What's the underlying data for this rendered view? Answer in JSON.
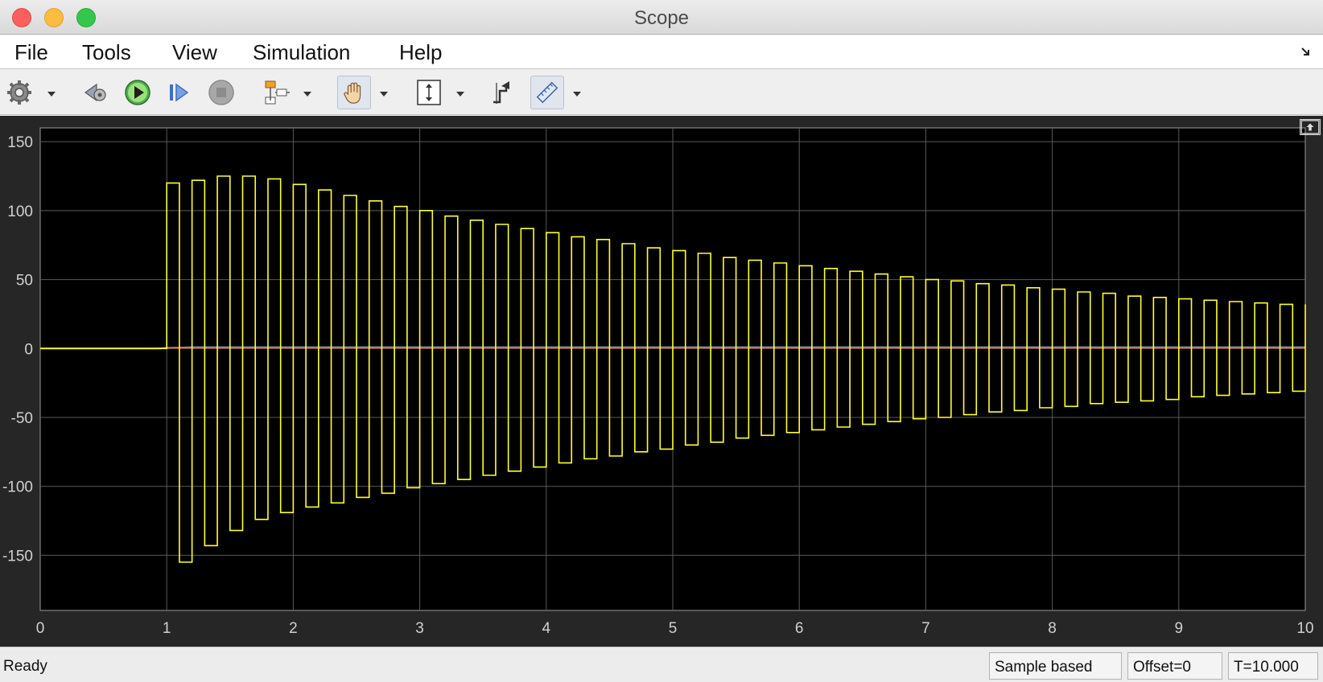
{
  "window": {
    "title": "Scope"
  },
  "menu": {
    "file": "File",
    "tools": "Tools",
    "view": "View",
    "simulation": "Simulation",
    "help": "Help"
  },
  "toolbar": {
    "icons": [
      "gear-icon",
      "step-back-icon",
      "run-icon",
      "step-forward-icon",
      "stop-icon",
      "signal-routing-icon",
      "pan-hand-icon",
      "scale-axes-icon",
      "triggers-icon",
      "cursor-measurements-icon"
    ]
  },
  "status": {
    "text": "Ready",
    "mode": "Sample based",
    "offset": "Offset=0",
    "time": "T=10.000"
  },
  "colors": {
    "plot_background": "#000000",
    "panel_background": "#262626",
    "grid": "#5a5a5a",
    "signal_1": "#ffff33",
    "signal_2": "#3b8be8",
    "signal_3": "#e8792a"
  },
  "chart_data": {
    "type": "line",
    "title": "",
    "xlabel": "",
    "ylabel": "",
    "xlim": [
      0,
      10
    ],
    "ylim": [
      -190,
      160
    ],
    "xticks": [
      "0",
      "1",
      "2",
      "3",
      "4",
      "5",
      "6",
      "7",
      "8",
      "9",
      "10"
    ],
    "yticks": [
      "150",
      "100",
      "50",
      "0",
      "-50",
      "-100",
      "-150"
    ],
    "grid": true,
    "series": [
      {
        "color": "#ffff33",
        "style": "square-wave",
        "start_time": 1.0,
        "period": 0.2,
        "duty": 0.5,
        "positive_peaks": [
          120,
          122,
          125,
          125,
          123,
          119,
          115,
          111,
          107,
          103,
          100,
          96,
          93,
          90,
          87,
          84,
          81,
          79,
          76,
          73,
          71,
          69,
          66,
          64,
          62,
          60,
          58,
          56,
          54,
          52,
          50,
          49,
          47,
          46,
          44,
          43,
          41,
          40,
          38,
          37,
          36,
          35,
          34,
          33,
          32
        ],
        "negative_peaks": [
          -155,
          -143,
          -132,
          -124,
          -119,
          -115,
          -112,
          -108,
          -105,
          -101,
          -98,
          -95,
          -92,
          -89,
          -86,
          -83,
          -80,
          -78,
          -75,
          -73,
          -70,
          -68,
          -65,
          -63,
          -61,
          -59,
          -57,
          -55,
          -53,
          -51,
          -50,
          -48,
          -46,
          -45,
          -43,
          -42,
          -40,
          -39,
          -38,
          -37,
          -35,
          -34,
          -33,
          -32,
          -31
        ]
      },
      {
        "color": "#3b8be8",
        "style": "line",
        "x": [
          0,
          0.9,
          1.0,
          1.2,
          10
        ],
        "values": [
          0,
          0,
          0.3,
          1,
          1
        ]
      },
      {
        "color": "#e8792a",
        "style": "line",
        "x": [
          0,
          0.95,
          1.0,
          10
        ],
        "values": [
          0,
          0,
          0.5,
          0.5
        ]
      }
    ]
  }
}
